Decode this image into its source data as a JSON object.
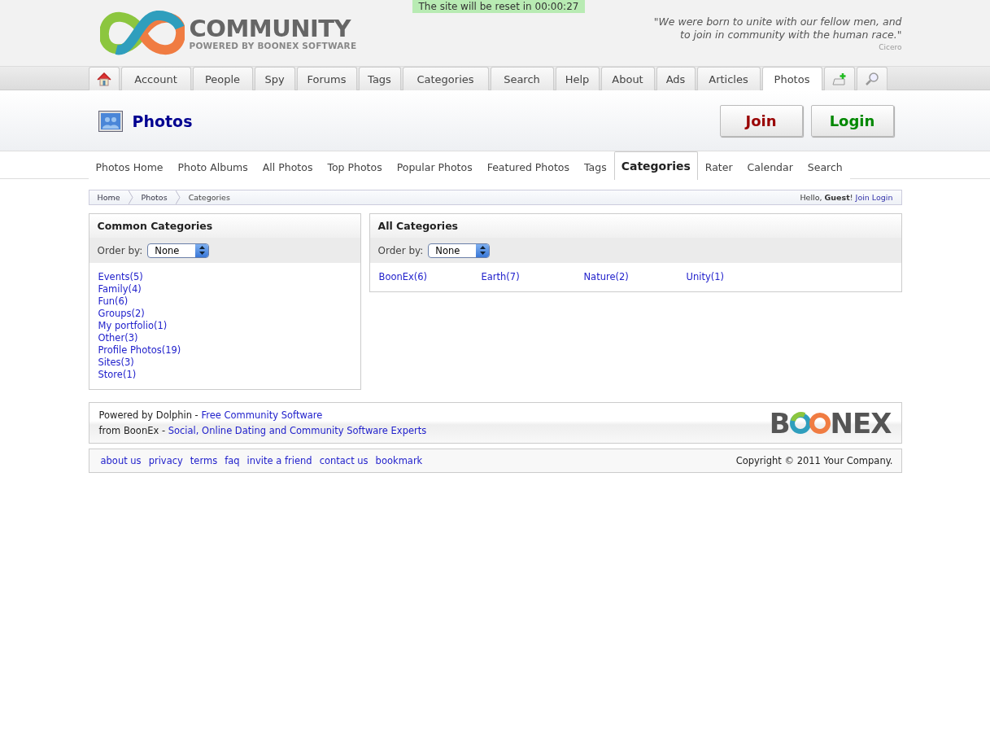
{
  "notice": "The site will be reset in 00:00:27",
  "logo": {
    "title": "COMMUNITY",
    "subtitle": "POWERED BY BOONEX SOFTWARE"
  },
  "quote": {
    "lines": [
      "\"We were born to unite with our fellow men, and",
      "to join in community with the human race.\""
    ],
    "author": "Cicero"
  },
  "main_tabs": [
    {
      "kind": "home",
      "selected": false
    },
    {
      "kind": "text",
      "label": "Account",
      "selected": false
    },
    {
      "kind": "text",
      "label": "People",
      "selected": false
    },
    {
      "kind": "text",
      "label": "Spy",
      "selected": false
    },
    {
      "kind": "text",
      "label": "Forums",
      "selected": false
    },
    {
      "kind": "text",
      "label": "Tags",
      "selected": false
    },
    {
      "kind": "text",
      "label": "Categories",
      "selected": false
    },
    {
      "kind": "text",
      "label": "Search",
      "selected": false
    },
    {
      "kind": "text",
      "label": "Help",
      "selected": false
    },
    {
      "kind": "text",
      "label": "About",
      "selected": false
    },
    {
      "kind": "text",
      "label": "Ads",
      "selected": false
    },
    {
      "kind": "text",
      "label": "Articles",
      "selected": false
    },
    {
      "kind": "text",
      "label": "Photos",
      "selected": true
    },
    {
      "kind": "add",
      "selected": false
    },
    {
      "kind": "search",
      "selected": false
    }
  ],
  "page_title": "Photos",
  "buttons": [
    {
      "kind": "join",
      "label": "Join"
    },
    {
      "kind": "login",
      "label": "Login"
    }
  ],
  "sub_tabs": [
    {
      "label": "Photos Home",
      "selected": false
    },
    {
      "label": "Photo Albums",
      "selected": false
    },
    {
      "label": "All Photos",
      "selected": false
    },
    {
      "label": "Top Photos",
      "selected": false
    },
    {
      "label": "Popular Photos",
      "selected": false
    },
    {
      "label": "Featured Photos",
      "selected": false
    },
    {
      "label": "Tags",
      "selected": false
    },
    {
      "label": "Categories",
      "selected": true
    },
    {
      "label": "Rater",
      "selected": false
    },
    {
      "label": "Calendar",
      "selected": false
    },
    {
      "label": "Search",
      "selected": false
    }
  ],
  "breadcrumb": [
    "Home",
    "Photos",
    "Categories"
  ],
  "greeting": {
    "text": "Hello, **Guest**!",
    "links": [
      "Join",
      "Login"
    ]
  },
  "common_categories": {
    "title": "Common Categories",
    "order_label": "Order by:",
    "order_value": "None",
    "items": [
      "Events(5)",
      "Family(4)",
      "Fun(6)",
      "Groups(2)",
      "My portfolio(1)",
      "Other(3)",
      "Profile Photos(19)",
      "Sites(3)",
      "Store(1)"
    ]
  },
  "all_categories": {
    "title": "All Categories",
    "order_label": "Order by:",
    "order_value": "None",
    "items": [
      "BoonEx(6)",
      "Earth(7)",
      "Nature(2)",
      "Unity(1)"
    ]
  },
  "footer": {
    "lines": [
      {
        "text": "Powered by Dolphin - ",
        "link": "Free Community Software"
      },
      {
        "text": "from BoonEx - ",
        "link": "Social, Online Dating and Community Software Experts"
      }
    ],
    "logo": {
      "left": "B",
      "right": "NEX"
    }
  },
  "bottom_links": [
    "about us",
    "privacy",
    "terms",
    "faq",
    "invite a friend",
    "contact us",
    "bookmark"
  ],
  "copyright": "Copyright © 2011 Your Company."
}
